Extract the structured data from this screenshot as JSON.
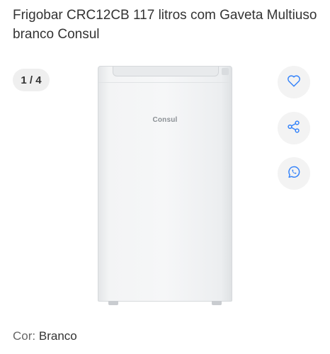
{
  "product": {
    "title": "Frigobar CRC12CB 117 litros com Gaveta Multiuso branco Consul",
    "image_counter": "1 / 4",
    "image_brand_text": "Consul"
  },
  "actions": {
    "favorite_icon": "heart-icon",
    "share_icon": "share-icon",
    "whatsapp_icon": "whatsapp-icon"
  },
  "variant": {
    "label": "Cor:",
    "value": "Branco"
  },
  "colors": {
    "accent": "#3483fa",
    "button_bg": "#f3f3f3"
  }
}
